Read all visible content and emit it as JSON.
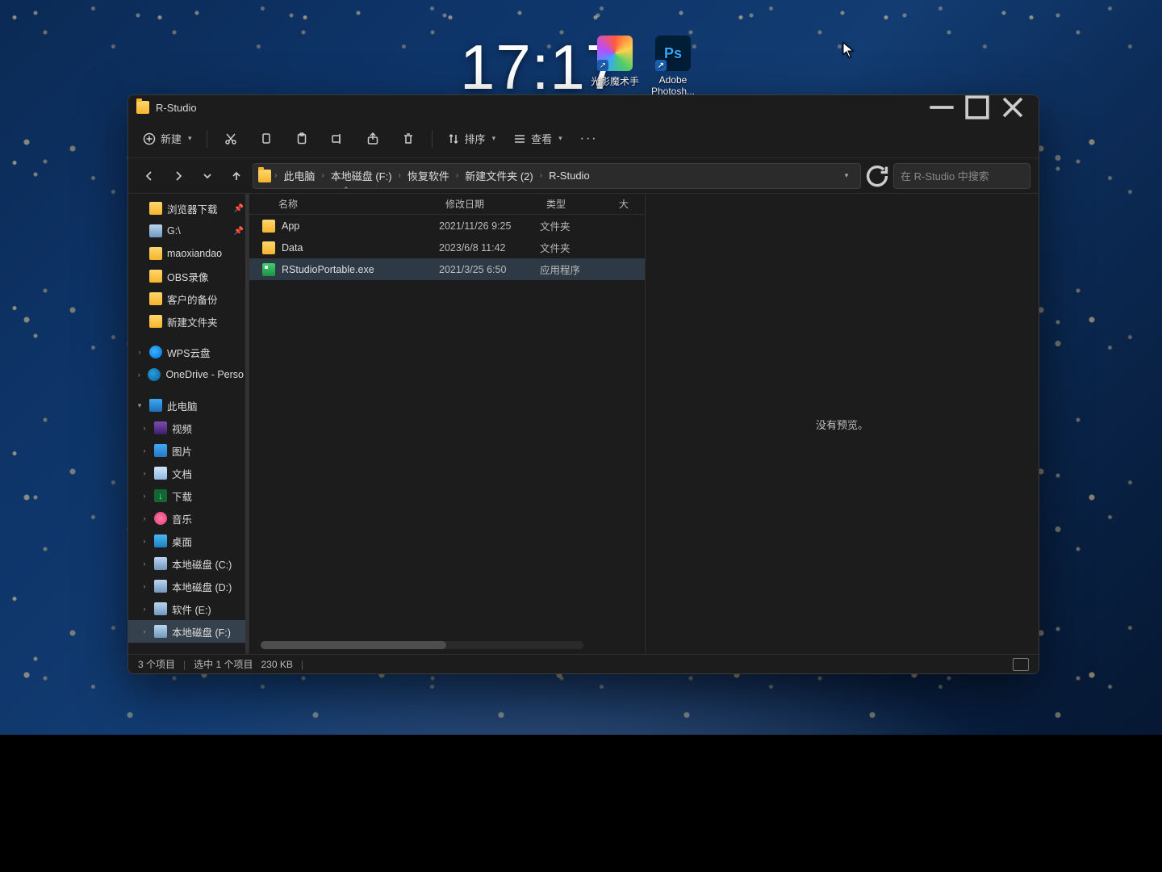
{
  "desktop": {
    "clock": "17:17",
    "icons": [
      {
        "label": "光影魔术手",
        "color1": "#ffd24d",
        "color2": "#ff6a3d"
      },
      {
        "label": "Adobe Photosh...",
        "color1": "#001e36",
        "color2": "#31a8ff",
        "text": "Ps"
      }
    ]
  },
  "window": {
    "title": "R-Studio",
    "toolbar": {
      "new": "新建",
      "sort": "排序",
      "view": "查看"
    },
    "breadcrumbs": [
      "此电脑",
      "本地磁盘 (F:)",
      "恢复软件",
      "新建文件夹 (2)",
      "R-Studio"
    ],
    "search_placeholder": "在 R-Studio 中搜索",
    "sidebar": {
      "quick": [
        {
          "label": "浏览器下载",
          "icon": "folder",
          "pinned": true
        },
        {
          "label": "G:\\",
          "icon": "drive",
          "pinned": true
        },
        {
          "label": "maoxiandao",
          "icon": "folder"
        },
        {
          "label": "OBS录像",
          "icon": "folder"
        },
        {
          "label": "客户的备份",
          "icon": "folder"
        },
        {
          "label": "新建文件夹",
          "icon": "folder"
        }
      ],
      "clouds": [
        {
          "label": "WPS云盘",
          "icon": "cloud"
        },
        {
          "label": "OneDrive - Perso",
          "icon": "onedrive"
        }
      ],
      "pc_label": "此电脑",
      "pc_children": [
        {
          "label": "视频",
          "icon": "video"
        },
        {
          "label": "图片",
          "icon": "pic"
        },
        {
          "label": "文档",
          "icon": "doc"
        },
        {
          "label": "下载",
          "icon": "dl"
        },
        {
          "label": "音乐",
          "icon": "music"
        },
        {
          "label": "桌面",
          "icon": "desk"
        },
        {
          "label": "本地磁盘 (C:)",
          "icon": "drive"
        },
        {
          "label": "本地磁盘 (D:)",
          "icon": "drive"
        },
        {
          "label": "软件 (E:)",
          "icon": "drive"
        },
        {
          "label": "本地磁盘 (F:)",
          "icon": "drive",
          "selected": true
        }
      ]
    },
    "columns": {
      "name": "名称",
      "date": "修改日期",
      "type": "类型",
      "size": "大"
    },
    "rows": [
      {
        "name": "App",
        "date": "2021/11/26 9:25",
        "type": "文件夹",
        "icon": "folder"
      },
      {
        "name": "Data",
        "date": "2023/6/8 11:42",
        "type": "文件夹",
        "icon": "folder"
      },
      {
        "name": "RStudioPortable.exe",
        "date": "2021/3/25 6:50",
        "type": "应用程序",
        "icon": "exe",
        "selected": true
      }
    ],
    "preview_text": "没有预览。",
    "status": {
      "items": "3 个项目",
      "selected": "选中 1 个项目",
      "size": "230 KB"
    }
  }
}
